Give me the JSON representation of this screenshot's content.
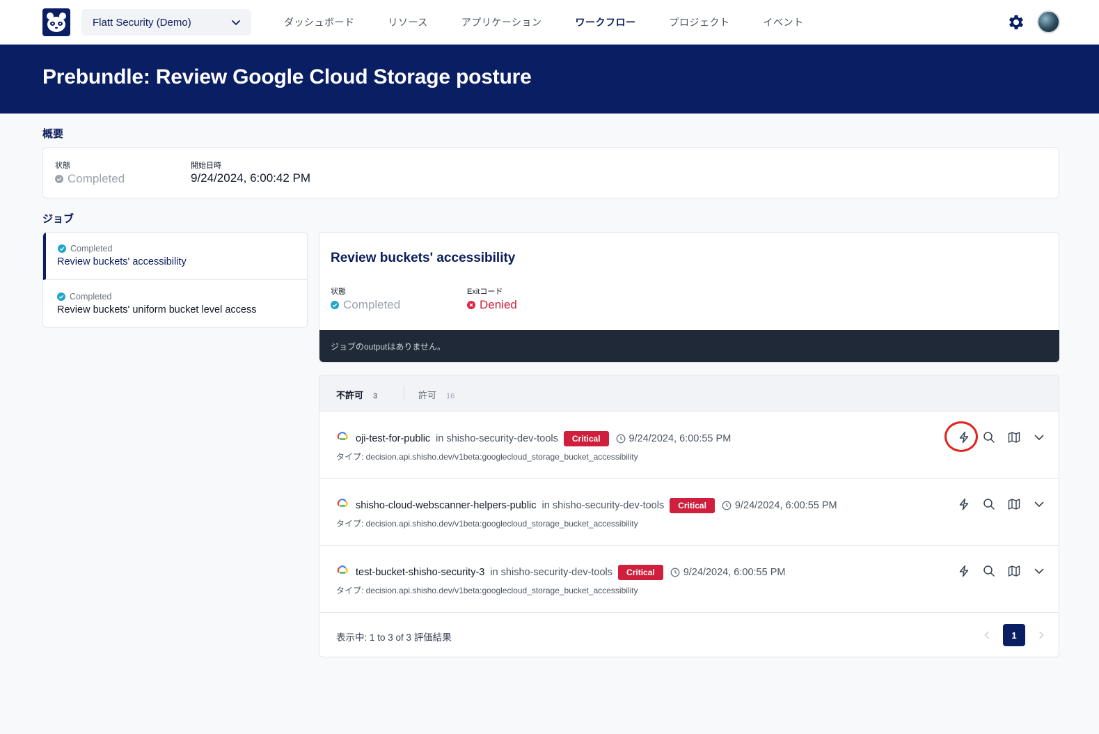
{
  "nav": {
    "org_name": "Flatt Security (Demo)",
    "items": [
      {
        "label": "ダッシュボード",
        "active": false
      },
      {
        "label": "リソース",
        "active": false
      },
      {
        "label": "アプリケーション",
        "active": false
      },
      {
        "label": "ワークフロー",
        "active": true
      },
      {
        "label": "プロジェクト",
        "active": false
      },
      {
        "label": "イベント",
        "active": false
      }
    ]
  },
  "page": {
    "title": "Prebundle: Review Google Cloud Storage posture"
  },
  "overview": {
    "heading": "概要",
    "state_label": "状態",
    "state_value": "Completed",
    "start_label": "開始日時",
    "start_value": "9/24/2024, 6:00:42 PM"
  },
  "jobs": {
    "heading": "ジョブ",
    "items": [
      {
        "status": "Completed",
        "name": "Review buckets' accessibility",
        "selected": true
      },
      {
        "status": "Completed",
        "name": "Review buckets' uniform bucket level access",
        "selected": false
      }
    ]
  },
  "job_detail": {
    "title": "Review buckets' accessibility",
    "state_label": "状態",
    "state_value": "Completed",
    "exit_label": "Exitコード",
    "exit_value": "Denied",
    "output_message": "ジョブのoutputはありません。"
  },
  "results": {
    "tabs": [
      {
        "label": "不許可",
        "count": "3",
        "active": true
      },
      {
        "label": "許可",
        "count": "16",
        "active": false
      }
    ],
    "rows": [
      {
        "name": "oji-test-for-public",
        "project": "in shisho-security-dev-tools",
        "severity": "Critical",
        "time": "9/24/2024, 6:00:55 PM",
        "type": "タイプ: decision.api.shisho.dev/v1beta:googlecloud_storage_bucket_accessibility"
      },
      {
        "name": "shisho-cloud-webscanner-helpers-public",
        "project": "in shisho-security-dev-tools",
        "severity": "Critical",
        "time": "9/24/2024, 6:00:55 PM",
        "type": "タイプ: decision.api.shisho.dev/v1beta:googlecloud_storage_bucket_accessibility"
      },
      {
        "name": "test-bucket-shisho-security-3",
        "project": "in shisho-security-dev-tools",
        "severity": "Critical",
        "time": "9/24/2024, 6:00:55 PM",
        "type": "タイプ: decision.api.shisho.dev/v1beta:googlecloud_storage_bucket_accessibility"
      }
    ],
    "footer_text": "表示中: 1 to 3 of 3 評価結果",
    "current_page": "1"
  },
  "icons": {
    "logo": "panda-logo-icon",
    "settings": "gear-icon",
    "row_actions": [
      "bolt-icon",
      "search-icon",
      "map-icon",
      "chevron-down-icon"
    ]
  },
  "colors": {
    "brand_navy": "#0a1f63",
    "critical": "#cf1f3d",
    "denied": "#dc2645",
    "completed": "#1fa5c9",
    "highlight_ring": "#e4231c"
  }
}
